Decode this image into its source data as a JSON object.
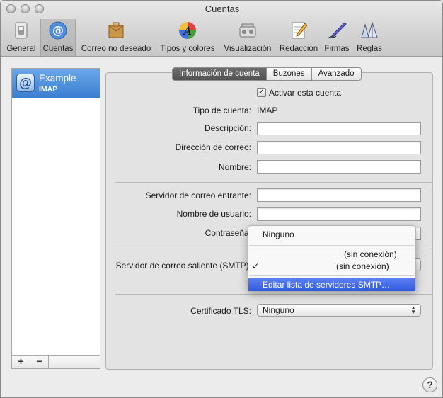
{
  "window": {
    "title": "Cuentas"
  },
  "toolbar": {
    "items": [
      {
        "label": "General",
        "icon": "switch-icon"
      },
      {
        "label": "Cuentas",
        "icon": "at-sign-icon",
        "selected": true
      },
      {
        "label": "Correo no deseado",
        "icon": "junk-mail-icon"
      },
      {
        "label": "Tipos y colores",
        "icon": "font-colors-icon"
      },
      {
        "label": "Visualización",
        "icon": "viewing-icon"
      },
      {
        "label": "Redacción",
        "icon": "composing-icon"
      },
      {
        "label": "Firmas",
        "icon": "signature-pen-icon"
      },
      {
        "label": "Reglas",
        "icon": "rules-icon"
      }
    ]
  },
  "sidebar": {
    "account": {
      "name": "Example",
      "type": "IMAP"
    },
    "add_label": "+",
    "remove_label": "−"
  },
  "tabs": [
    {
      "label": "Información de cuenta",
      "selected": true
    },
    {
      "label": "Buzones",
      "selected": false
    },
    {
      "label": "Avanzado",
      "selected": false
    }
  ],
  "form": {
    "enable_label": "Activar esta cuenta",
    "enable_checked": true,
    "check_mark": "✓",
    "account_type_label": "Tipo de cuenta:",
    "account_type_value": "IMAP",
    "description_label": "Descripción:",
    "description_value": "",
    "email_label": "Dirección de correo:",
    "email_value": "",
    "name_label": "Nombre:",
    "name_value": "",
    "incoming_label": "Servidor de correo entrante:",
    "incoming_value": "",
    "username_label": "Nombre de usuario:",
    "username_value": "",
    "password_label": "Contraseña:",
    "smtp_label": "Servidor de correo saliente (SMTP):",
    "tls_label": "Certificado TLS:",
    "tls_value": "Ninguno"
  },
  "smtp_menu": {
    "items": [
      {
        "label": "Ninguno"
      },
      {
        "label": "(sin conexión)"
      },
      {
        "label": "(sin conexión)",
        "checked": true,
        "check": "✓"
      },
      {
        "label": "Editar lista de servidores SMTP…",
        "highlighted": true
      }
    ]
  },
  "help_label": "?"
}
